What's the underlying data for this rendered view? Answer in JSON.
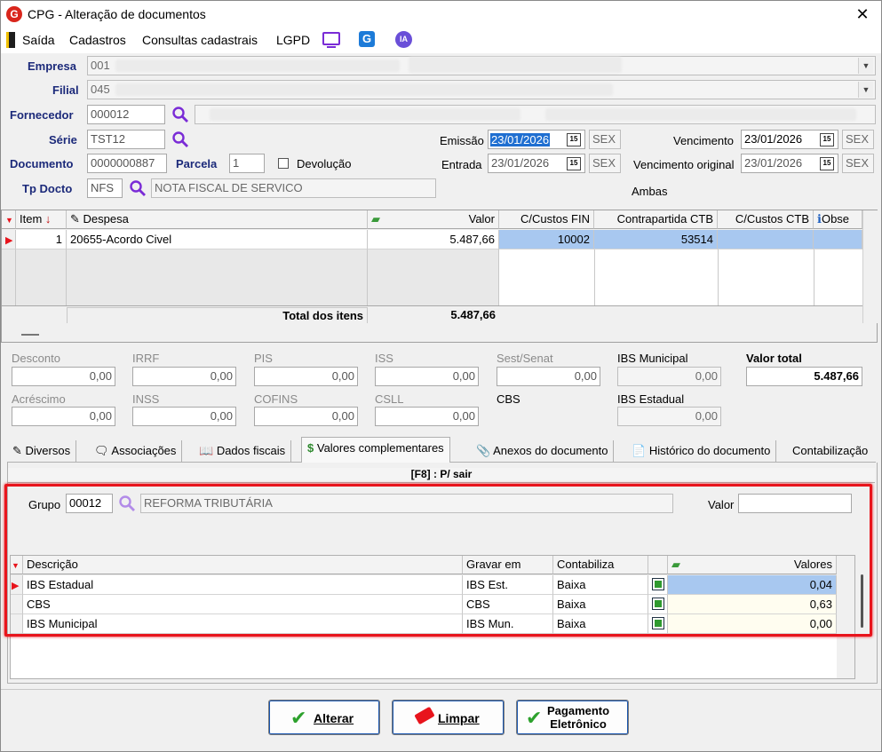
{
  "window": {
    "title": "CPG - Alteração de documentos",
    "logo_letter": "G"
  },
  "menu": {
    "saida": "Saída",
    "cadastros": "Cadastros",
    "consultas": "Consultas cadastrais",
    "lgpd": "LGPD",
    "ia_label": "IA",
    "g_label": "G"
  },
  "header": {
    "empresa_label": "Empresa",
    "empresa_value": "001",
    "filial_label": "Filial",
    "filial_value": "045",
    "fornecedor_label": "Fornecedor",
    "fornecedor_value": "000012",
    "serie_label": "Série",
    "serie_value": "TST12",
    "documento_label": "Documento",
    "documento_value": "0000000887",
    "parcela_label": "Parcela",
    "parcela_value": "1",
    "devolucao_label": "Devolução",
    "tpdocto_label": "Tp Docto",
    "tpdocto_value": "NFS",
    "tpdocto_desc": "NOTA FISCAL DE SERVICO",
    "emissao_label": "Emissão",
    "emissao_value": "23/01/2026",
    "emissao_day": "SEX",
    "entrada_label": "Entrada",
    "entrada_value": "23/01/2026",
    "entrada_day": "SEX",
    "vencimento_label": "Vencimento",
    "vencimento_value": "23/01/2026",
    "vencimento_day": "SEX",
    "venc_orig_label": "Vencimento original",
    "venc_orig_value": "23/01/2026",
    "venc_orig_day": "SEX",
    "ambas_label": "Ambas",
    "cal_glyph": "15"
  },
  "items_grid": {
    "columns": {
      "item": "Item",
      "despesa": "Despesa",
      "valor": "Valor",
      "ccfin": "C/Custos FIN",
      "contrapartida": "Contrapartida CTB",
      "ccctb": "C/Custos CTB",
      "obs": "Obse"
    },
    "rows": [
      {
        "item": "1",
        "despesa": "20655-Acordo Civel",
        "valor": "5.487,66",
        "ccfin": "10002",
        "contrapartida": "53514",
        "ccctb": ""
      }
    ],
    "total_label": "Total dos itens",
    "total_value": "5.487,66"
  },
  "taxes": {
    "desconto": {
      "label": "Desconto",
      "value": "0,00"
    },
    "irrf": {
      "label": "IRRF",
      "value": "0,00"
    },
    "pis": {
      "label": "PIS",
      "value": "0,00"
    },
    "iss": {
      "label": "ISS",
      "value": "0,00"
    },
    "sest": {
      "label": "Sest/Senat",
      "value": "0,00"
    },
    "ibs_mun": {
      "label": "IBS Municipal",
      "value": "0,00"
    },
    "valor_total": {
      "label": "Valor total",
      "value": "5.487,66"
    },
    "acrescimo": {
      "label": "Acréscimo",
      "value": "0,00"
    },
    "inss": {
      "label": "INSS",
      "value": "0,00"
    },
    "cofins": {
      "label": "COFINS",
      "value": "0,00"
    },
    "csll": {
      "label": "CSLL",
      "value": "0,00"
    },
    "cbs": {
      "label": "CBS"
    },
    "ibs_est": {
      "label": "IBS Estadual",
      "value": "0,00"
    }
  },
  "tabs": [
    {
      "label": "Diversos"
    },
    {
      "label": "Associações"
    },
    {
      "label": "Dados fiscais"
    },
    {
      "label": "Valores complementares"
    },
    {
      "label": "Anexos do documento"
    },
    {
      "label": "Histórico do documento"
    },
    {
      "label": "Contabilização"
    }
  ],
  "panel": {
    "caption": "[F8] : P/ sair",
    "grupo_label": "Grupo",
    "grupo_value": "00012",
    "grupo_desc": "REFORMA TRIBUTÁRIA",
    "valor_label": "Valor",
    "valor_value": "",
    "columns": {
      "descricao": "Descrição",
      "gravar": "Gravar em",
      "contabiliza": "Contabiliza",
      "valores": "Valores"
    },
    "rows": [
      {
        "descricao": "IBS Estadual",
        "gravar": "IBS Est.",
        "contabiliza": "Baixa",
        "valor": "0,04"
      },
      {
        "descricao": "CBS",
        "gravar": "CBS",
        "contabiliza": "Baixa",
        "valor": "0,63"
      },
      {
        "descricao": "IBS Municipal",
        "gravar": "IBS Mun.",
        "contabiliza": "Baixa",
        "valor": "0,00"
      }
    ]
  },
  "buttons": {
    "alterar": "Alterar",
    "limpar": "Limpar",
    "pagamento_1": "Pagamento",
    "pagamento_2": "Eletrônico"
  },
  "colors": {
    "highlight_red": "#e8141c",
    "accent_purple": "#7a2bd6",
    "row_selected": "#a8c8f0"
  }
}
